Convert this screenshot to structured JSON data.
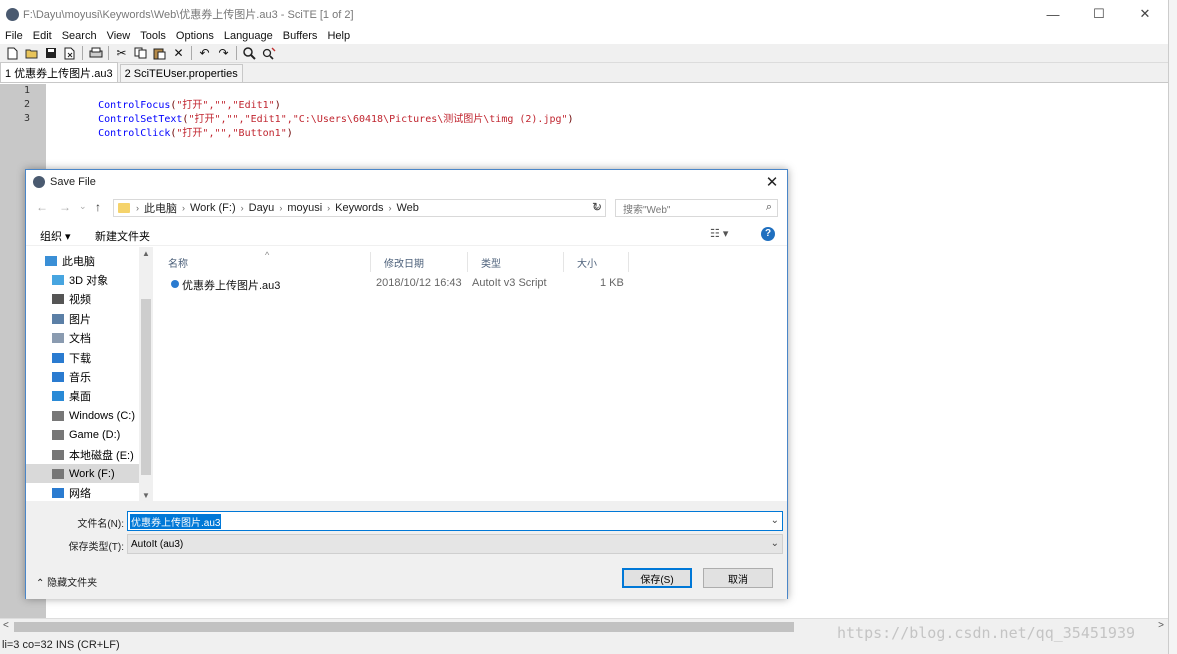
{
  "window": {
    "title": "F:\\Dayu\\moyusi\\Keywords\\Web\\优惠券上传图片.au3 - SciTE [1 of 2]",
    "controls": [
      "—",
      "☐",
      "✕"
    ]
  },
  "menu": [
    "File",
    "Edit",
    "Search",
    "View",
    "Tools",
    "Options",
    "Language",
    "Buffers",
    "Help"
  ],
  "toolbar": [
    "new-icon",
    "open-icon",
    "save-icon",
    "close-file-icon",
    "print-icon",
    "cut-icon",
    "copy-icon",
    "paste-icon",
    "delete-icon",
    "undo-icon",
    "redo-icon",
    "find-icon",
    "replace-icon"
  ],
  "tabs": [
    "1 优惠券上传图片.au3",
    "2 SciTEUser.properties"
  ],
  "code": {
    "line_numbers": [
      "1",
      "2",
      "3"
    ],
    "lines": [
      {
        "fn": "ControlFocus",
        "open": "(",
        "args": "\"打开\",\"\",\"Edit1\"",
        "close": ")"
      },
      {
        "fn": "ControlSetText",
        "open": "(",
        "args": "\"打开\",\"\",\"Edit1\",\"C:\\Users\\60418\\Pictures\\测试图片\\timg (2).jpg\"",
        "close": ")"
      },
      {
        "fn": "ControlClick",
        "open": "(",
        "args": "\"打开\",\"\",\"Button1\"",
        "close": ")"
      }
    ]
  },
  "status": "li=3 co=32 INS (CR+LF)",
  "watermark": "https://blog.csdn.net/qq_35451939",
  "dialog": {
    "title": "Save File",
    "close": "✕",
    "nav": {
      "back": "←",
      "forward": "→",
      "recent": "⌄",
      "up": "↑"
    },
    "breadcrumb": [
      "此电脑",
      "Work (F:)",
      "Dayu",
      "moyusi",
      "Keywords",
      "Web"
    ],
    "search_placeholder": "搜索\"Web\"",
    "organize": "组织 ▾",
    "new_folder": "新建文件夹",
    "view_options": "☷ ▾",
    "help": "?",
    "nav_items": [
      {
        "label": "此电脑",
        "icon": "pc-icon",
        "color": "#3a8fd6"
      },
      {
        "label": "3D 对象",
        "icon": "3d-objects-icon",
        "color": "#47a5e0"
      },
      {
        "label": "视频",
        "icon": "video-icon",
        "color": "#555"
      },
      {
        "label": "图片",
        "icon": "pictures-icon",
        "color": "#5b7fa6"
      },
      {
        "label": "文档",
        "icon": "documents-icon",
        "color": "#8a9bb0"
      },
      {
        "label": "下载",
        "icon": "downloads-icon",
        "color": "#2a7bd0"
      },
      {
        "label": "音乐",
        "icon": "music-icon",
        "color": "#2a7bd0"
      },
      {
        "label": "桌面",
        "icon": "desktop-icon",
        "color": "#2a8ad6"
      },
      {
        "label": "Windows (C:)",
        "icon": "drive-icon",
        "color": "#777"
      },
      {
        "label": "Game (D:)",
        "icon": "drive-icon",
        "color": "#777"
      },
      {
        "label": "本地磁盘 (E:)",
        "icon": "drive-icon",
        "color": "#777"
      },
      {
        "label": "Work (F:)",
        "icon": "drive-icon",
        "color": "#777"
      },
      {
        "label": "网络",
        "icon": "network-icon",
        "color": "#2a7bd0"
      }
    ],
    "columns": [
      "名称",
      "修改日期",
      "类型",
      "大小"
    ],
    "files": [
      {
        "name": "优惠券上传图片.au3",
        "modified": "2018/10/12 16:43",
        "type": "AutoIt v3 Script",
        "size": "1 KB"
      }
    ],
    "filename_label": "文件名(N):",
    "filename_value": "优惠券上传图片.au3",
    "filetype_label": "保存类型(T):",
    "filetype_value": "AutoIt (au3)",
    "hide_folders": "隐藏文件夹",
    "save": "保存(S)",
    "cancel": "取消"
  }
}
